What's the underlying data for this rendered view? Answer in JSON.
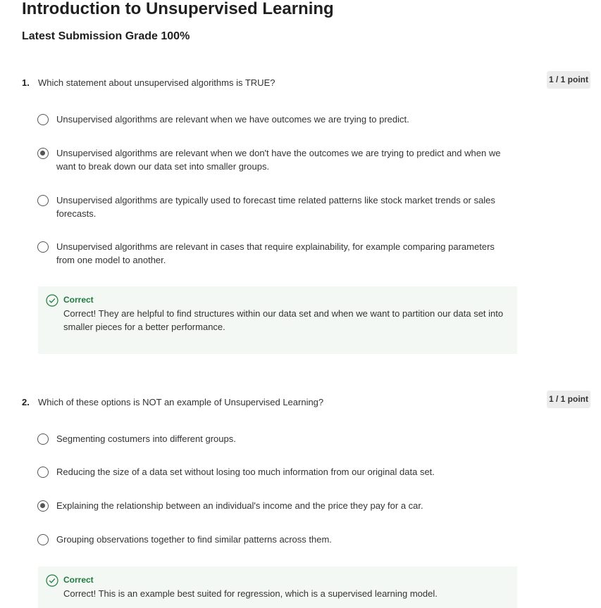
{
  "page": {
    "title": "Introduction to Unsupervised Learning",
    "grade": "Latest Submission Grade 100%"
  },
  "questions": [
    {
      "number": "1.",
      "text": "Which statement about unsupervised algorithms is TRUE?",
      "points": "1 / 1 point",
      "options": [
        {
          "label": "Unsupervised algorithms are relevant when we have outcomes we are trying to predict.",
          "selected": false
        },
        {
          "label": "Unsupervised algorithms are relevant when we don't have the outcomes we are trying to predict and when we want to break down our data set into smaller groups.",
          "selected": true
        },
        {
          "label": "Unsupervised algorithms are typically used to forecast time related patterns like stock market trends or sales forecasts.",
          "selected": false
        },
        {
          "label": "Unsupervised algorithms are relevant in cases that require explainability, for example comparing parameters from one model to another.",
          "selected": false
        }
      ],
      "feedback": {
        "title": "Correct",
        "text": "Correct! They are helpful to find structures within our data set and when we want to partition our data set into smaller pieces for a better performance."
      }
    },
    {
      "number": "2.",
      "text": "Which of these options is NOT an example of Unsupervised Learning?",
      "points": "1 / 1 point",
      "options": [
        {
          "label": "Segmenting costumers into different groups.",
          "selected": false
        },
        {
          "label": "Reducing the size of a data set without losing too much information from our original data set.",
          "selected": false
        },
        {
          "label": "Explaining the relationship between an individual's income and the price they pay for a car.",
          "selected": true
        },
        {
          "label": "Grouping observations together to find similar patterns across them.",
          "selected": false
        }
      ],
      "feedback": {
        "title": "Correct",
        "text": "Correct! This is an example best suited for regression, which is a supervised learning model."
      }
    }
  ],
  "colors": {
    "correct_green": "#1e7a3c",
    "feedback_bg": "#f4f8f5",
    "points_bg": "#ececec"
  },
  "icons": {
    "radio": "radio-button",
    "feedback": "check-circle-icon"
  }
}
